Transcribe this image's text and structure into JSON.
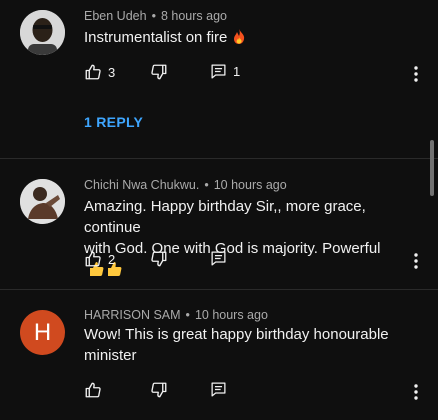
{
  "comments": [
    {
      "author": "Eben Udeh",
      "time": "8 hours ago",
      "text": "Instrumentalist on fire",
      "emoji": "fire",
      "likes": "3",
      "replies_count": "1",
      "reply_link": "1 REPLY"
    },
    {
      "author": "Chichi Nwa Chukwu.",
      "time": "10 hours ago",
      "text_line1": "Amazing. Happy birthday Sir,, more grace, continue",
      "text_line2": "with God. One with God is majority. Powerful",
      "emoji": "thumbs-up x2",
      "likes": "2"
    },
    {
      "author": "HARRISON SAM",
      "time": "10 hours ago",
      "avatar_letter": "H",
      "text_line1": "Wow! This is great happy birthday honourable",
      "text_line2": "minister"
    }
  ],
  "separator": "•",
  "colors": {
    "background": "#0f0f0f",
    "link": "#3ea6ff",
    "avatar_h": "#d04a1f",
    "meta": "#aaaaaa"
  },
  "icons": [
    "like-icon",
    "dislike-icon",
    "reply-icon",
    "more-vert-icon",
    "fire-emoji",
    "thumbs-up-emoji"
  ]
}
